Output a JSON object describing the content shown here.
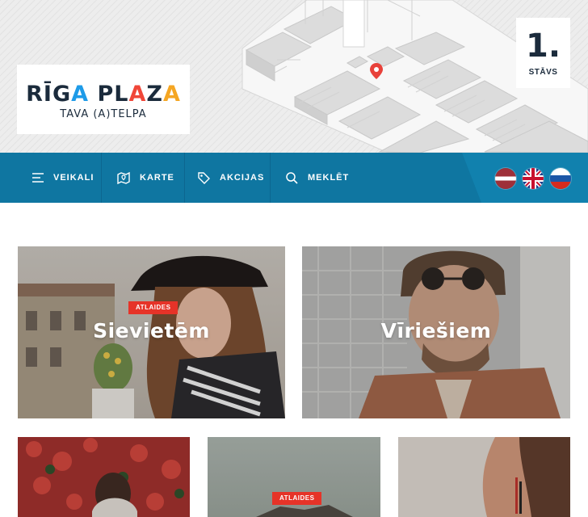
{
  "brand": {
    "name_part1": "RĪG",
    "name_a1": "A",
    "name_part2": " PL",
    "name_a2": "A",
    "name_part3": "Z",
    "name_a3": "A",
    "tagline": "TAVA (A)TELPA"
  },
  "floor": {
    "number": "1.",
    "label": "STĀVS"
  },
  "nav": {
    "items": [
      {
        "label": "VEIKALI",
        "icon": "menu-icon"
      },
      {
        "label": "KARTE",
        "icon": "map-icon"
      },
      {
        "label": "AKCIJAS",
        "icon": "tag-icon"
      },
      {
        "label": "MEKLĒT",
        "icon": "search-icon"
      }
    ],
    "languages": [
      {
        "code": "lv",
        "icon": "latvia-flag-icon"
      },
      {
        "code": "en",
        "icon": "uk-flag-icon"
      },
      {
        "code": "ru",
        "icon": "russia-flag-icon"
      }
    ]
  },
  "categories": [
    {
      "title": "Sievietēm",
      "badge": "ATLAIDES"
    },
    {
      "title": "Vīriešiem",
      "badge": ""
    },
    {
      "title": "",
      "badge": ""
    },
    {
      "title": "",
      "badge": "ATLAIDES"
    },
    {
      "title": "",
      "badge": ""
    }
  ],
  "colors": {
    "nav": "#0f76a1",
    "accent": "#e63328",
    "map_pin": "#e8413a",
    "text_dark": "#1b2b3c"
  }
}
